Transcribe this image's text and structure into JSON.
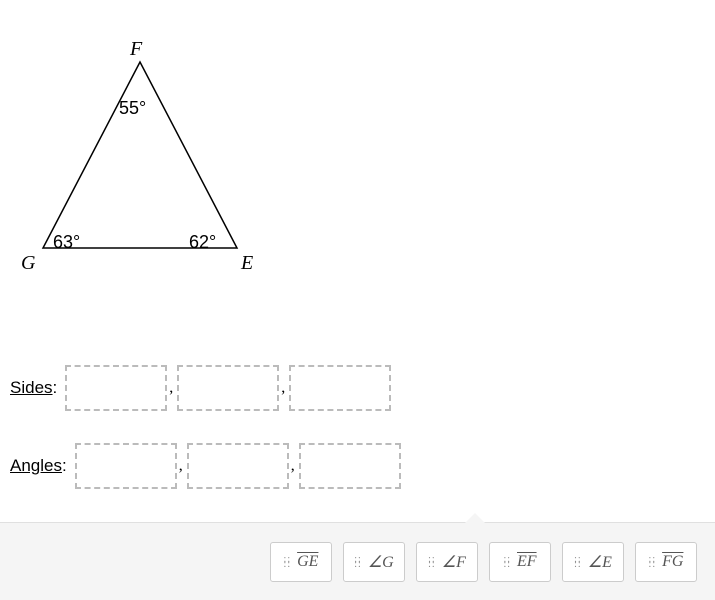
{
  "triangle": {
    "vertices": {
      "F": "F",
      "G": "G",
      "E": "E"
    },
    "angles": {
      "F": "55°",
      "G": "63°",
      "E": "62°"
    }
  },
  "labels": {
    "sides": "Sides",
    "angles": "Angles"
  },
  "tiles": [
    {
      "id": "tile-ge",
      "type": "segment",
      "text": "GE"
    },
    {
      "id": "tile-angle-g",
      "type": "angle",
      "text": "∠G"
    },
    {
      "id": "tile-angle-f",
      "type": "angle",
      "text": "∠F"
    },
    {
      "id": "tile-ef",
      "type": "segment",
      "text": "EF"
    },
    {
      "id": "tile-angle-e",
      "type": "angle",
      "text": "∠E"
    },
    {
      "id": "tile-fg",
      "type": "segment",
      "text": "FG"
    }
  ]
}
